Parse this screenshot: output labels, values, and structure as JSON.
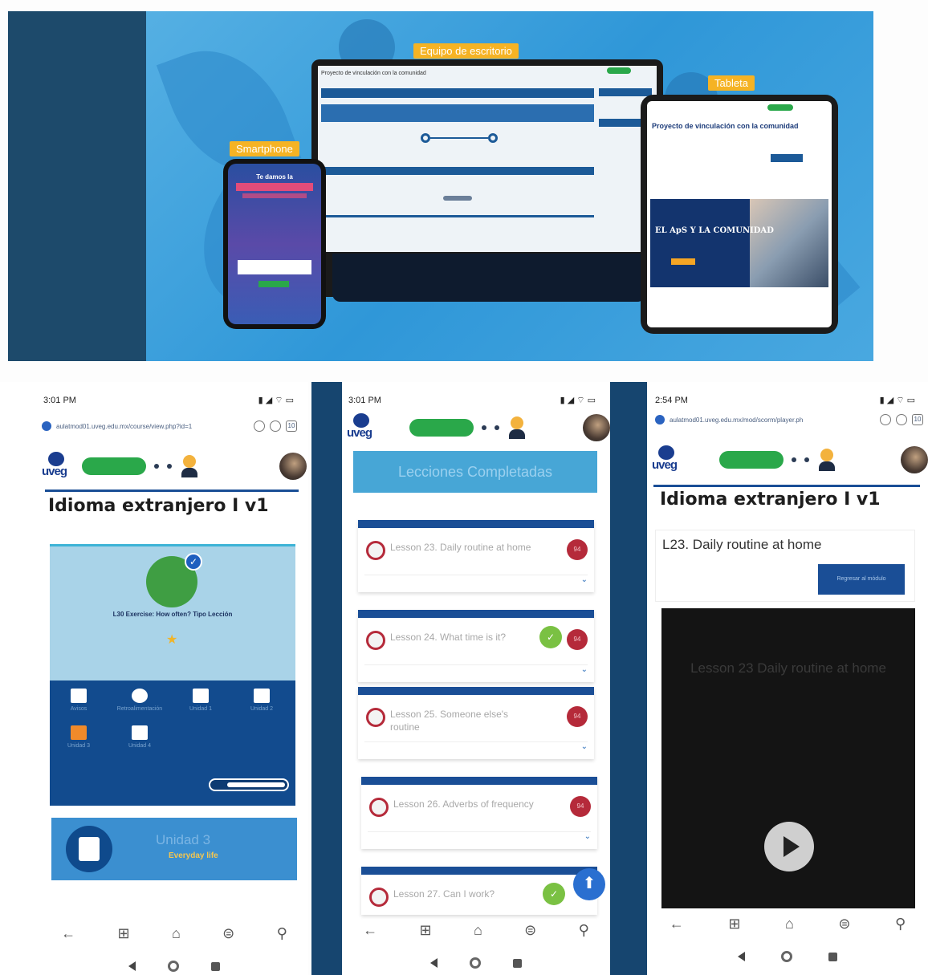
{
  "banner": {
    "laptop_label": "Equipo de escritorio",
    "phone_label": "Smartphone",
    "tablet_label": "Tableta",
    "laptop_page_title": "Proyecto de vinculación con la comunidad",
    "tablet_page_title": "Proyecto de vinculación con la comunidad",
    "tablet_hero_text": "EL ApS Y LA COMUNIDAD",
    "phone_headline": "Te damos la"
  },
  "panel1": {
    "time": "3:01 PM",
    "url": "aulatmod01.uveg.edu.mx/course/view.php?id=1",
    "logo": "uveg",
    "course_title": "Idioma extranjero I v1",
    "lesson_label": "L30 Exercise: How often? Tipo Lección",
    "menu": [
      "Avisos",
      "Retroalimentación",
      "Unidad 1",
      "Unidad 2",
      "Unidad 3",
      "Unidad 4"
    ],
    "unit_title": "Unidad 3",
    "unit_subtitle": "Everyday life",
    "progress": 0.8
  },
  "panel2": {
    "time": "3:01 PM",
    "logo": "uveg",
    "banner_title": "Lecciones Completadas",
    "lessons": [
      {
        "title": "Lesson 23. Daily routine at home",
        "badge": "94"
      },
      {
        "title": "Lesson 24. What time is it?",
        "badge": "94"
      },
      {
        "title": "Lesson 25. Someone else's routine",
        "badge": "94"
      },
      {
        "title": "Lesson 26. Adverbs of frequency",
        "badge": "94"
      },
      {
        "title": "Lesson 27. Can I work?",
        "badge": ""
      }
    ]
  },
  "panel3": {
    "time": "2:54 PM",
    "url": "aulatmod01.uveg.edu.mx/mod/scorm/player.ph",
    "logo": "uveg",
    "course_title": "Idioma extranjero I v1",
    "lesson_title": "L23. Daily routine at home",
    "return_button": "Regresar al módulo",
    "video_title": "Lesson 23 Daily routine at home"
  },
  "icons": {
    "nav_back": "←",
    "nav_book": "⊞",
    "nav_home": "⌂",
    "nav_game": "⊜",
    "nav_user": "⚲",
    "check": "✓",
    "chevron": "⌄",
    "up_arrow": "⬆",
    "star": "★",
    "status_right": "▮ ◢ ⌔ ▭",
    "tab_count": "10"
  },
  "colors": {
    "brand_blue": "#1a4e96",
    "accent_green": "#2aa84a",
    "lesson_red": "#b52a3a",
    "label_orange": "#f5b324"
  }
}
